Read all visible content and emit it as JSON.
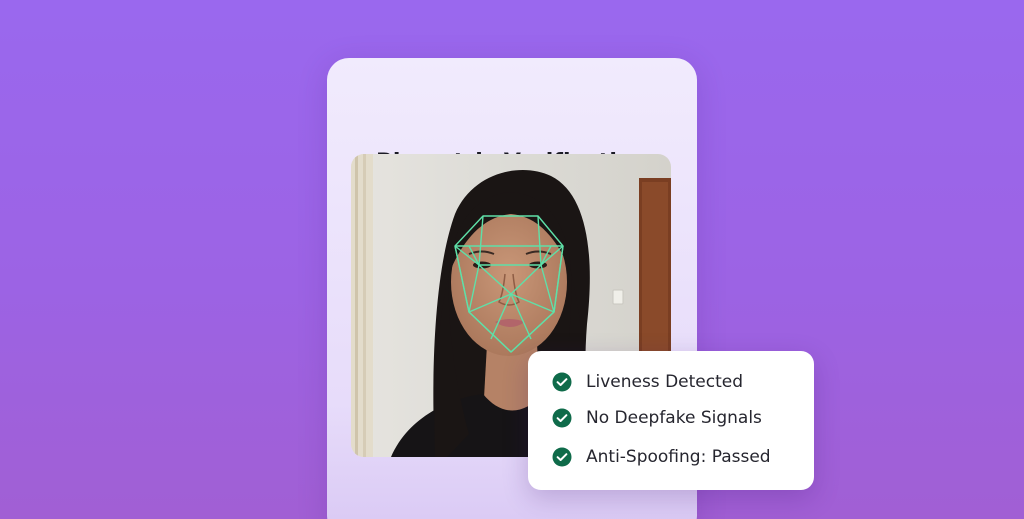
{
  "card": {
    "title": "Biometric Verification"
  },
  "photo": {
    "subject": "face-photo-with-mesh-overlay",
    "mesh_color": "#5fe0a8"
  },
  "checks": {
    "icon": "check-circle-icon",
    "icon_color": "#0f6b4a",
    "items": [
      {
        "label": "Liveness Detected"
      },
      {
        "label": "No Deepfake Signals"
      },
      {
        "label": "Anti-Spoofing: Passed"
      }
    ]
  },
  "colors": {
    "background": "#9a68ee",
    "card": "#f1ebfd",
    "title_text": "#1b1b25"
  }
}
